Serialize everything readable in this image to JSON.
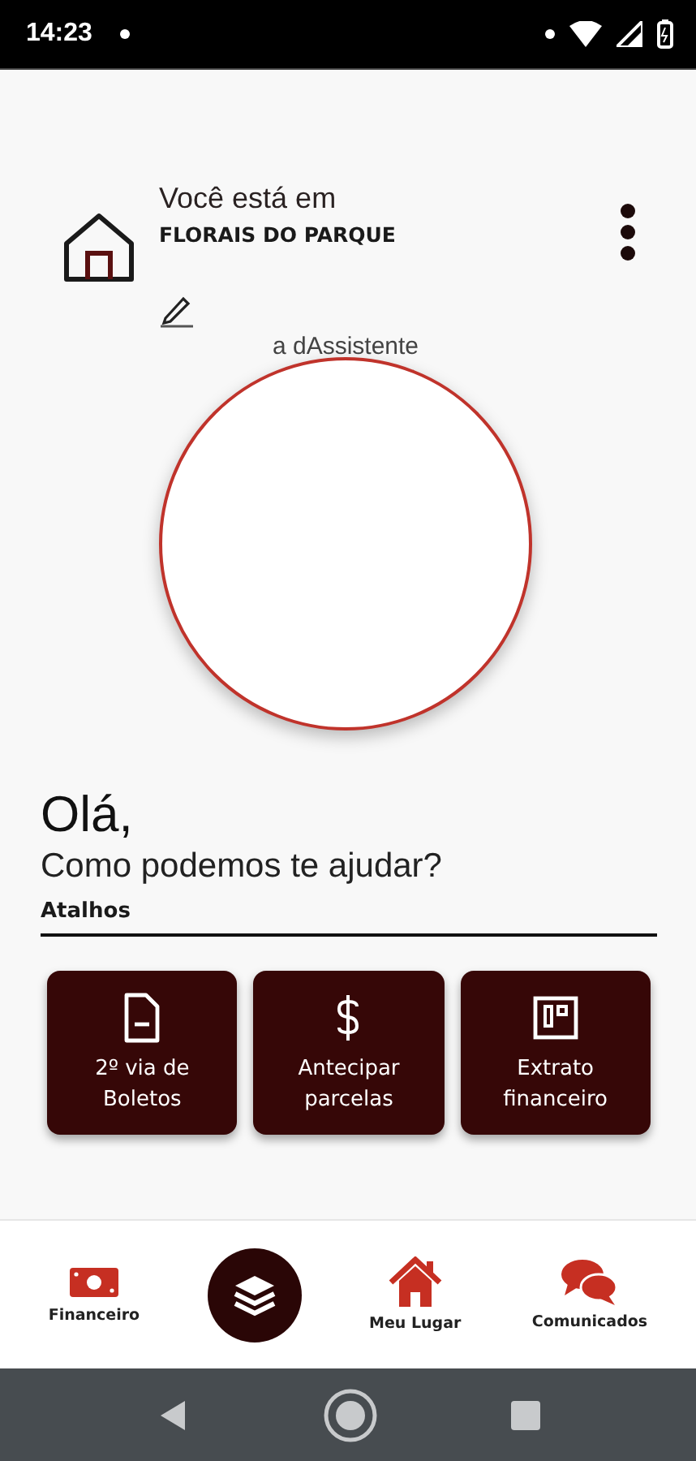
{
  "status_bar": {
    "time": "14:23"
  },
  "header": {
    "prefix": "Você está em",
    "place": "FLORAIS DO PARQUE"
  },
  "assistant": {
    "label": "a dAssistente"
  },
  "greeting": {
    "title": "Olá,",
    "subtitle": "Como podemos te ajudar?"
  },
  "shortcuts": {
    "title": "Atalhos",
    "items": [
      {
        "kind": "document",
        "label": "2º via de Boletos"
      },
      {
        "kind": "dollar",
        "label": "Antecipar parcelas"
      },
      {
        "kind": "statement",
        "label": "Extrato financeiro"
      }
    ]
  },
  "bottom_nav": [
    {
      "kind": "money",
      "label": "Financeiro"
    },
    {
      "kind": "layers"
    },
    {
      "kind": "home",
      "label": "Meu Lugar"
    },
    {
      "kind": "chat",
      "label": "Comunicados"
    }
  ]
}
